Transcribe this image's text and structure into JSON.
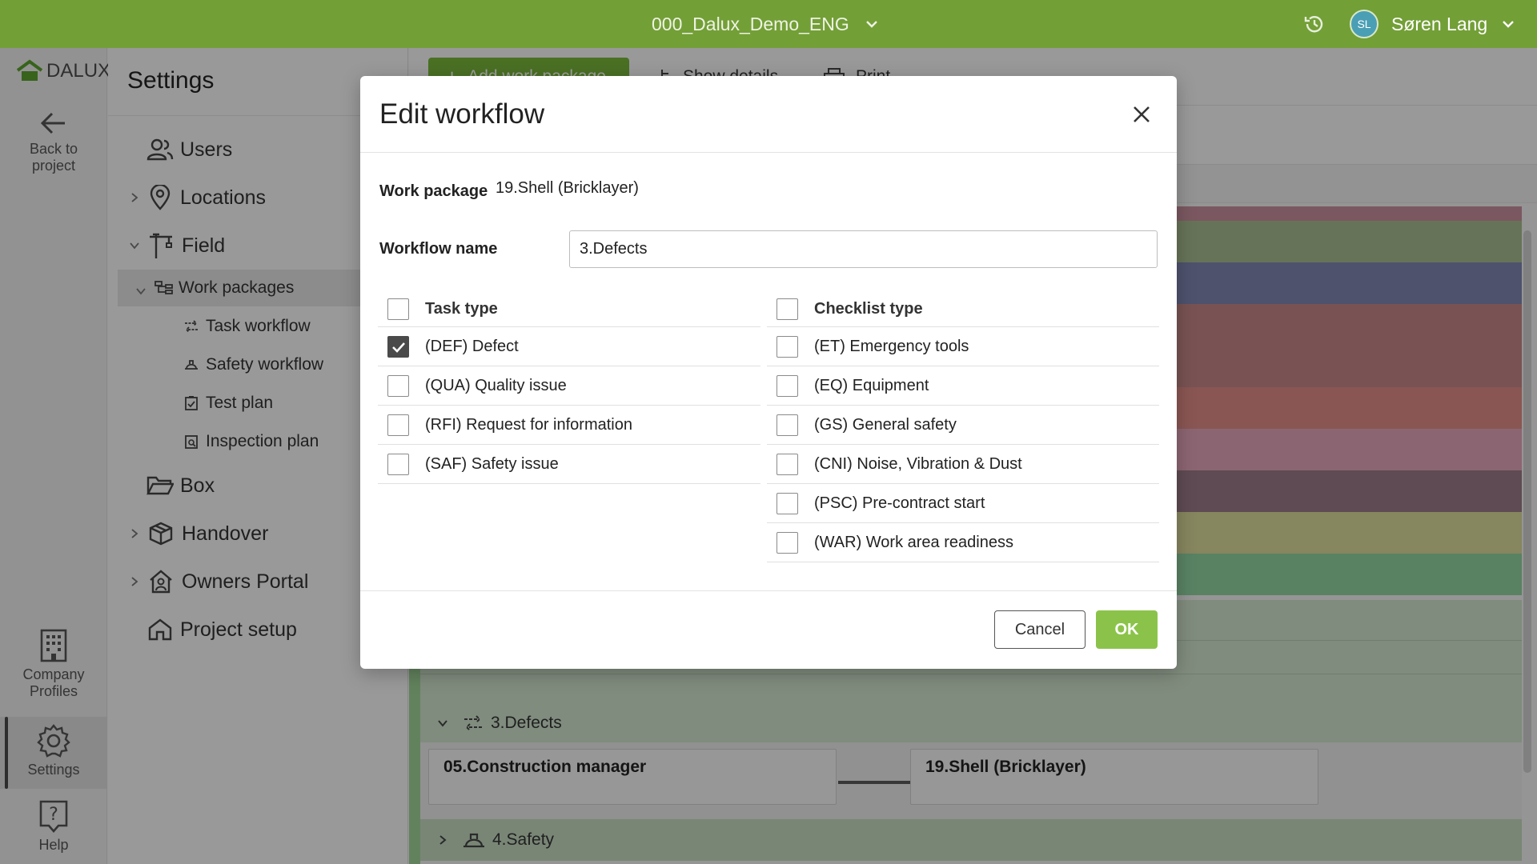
{
  "topbar": {
    "project_name": "000_Dalux_Demo_ENG",
    "user_initials": "SL",
    "user_name": "Søren Lang"
  },
  "rail": {
    "logo_text": "DALUX",
    "back_line1": "Back to",
    "back_line2": "project",
    "company_line1": "Company",
    "company_line2": "Profiles",
    "settings": "Settings",
    "help": "Help"
  },
  "sidebar": {
    "title": "Settings",
    "users": "Users",
    "locations": "Locations",
    "field": "Field",
    "work_packages": "Work packages",
    "task_workflow": "Task workflow",
    "safety_workflow": "Safety workflow",
    "test_plan": "Test plan",
    "inspection_plan": "Inspection plan",
    "box": "Box",
    "handover": "Handover",
    "owners_portal": "Owners Portal",
    "project_setup": "Project setup"
  },
  "content": {
    "add_work_package": "Add work package",
    "show_details": "Show details",
    "print": "Print",
    "workflow_row": "3.Defects",
    "flow_from": "05.Construction manager",
    "flow_to": "19.Shell (Bricklayer)",
    "safety_row": "4.Safety",
    "stripe_colors": [
      "#c78e9d",
      "#a6ba8f",
      "#7f85b0",
      "#c48686",
      "#c48686",
      "#df8b86",
      "#e3a4b8",
      "#9a7a87",
      "#d9d89a",
      "#90d2a0"
    ]
  },
  "modal": {
    "title": "Edit workflow",
    "work_package_label": "Work package",
    "work_package_value": "19.Shell (Bricklayer)",
    "workflow_name_label": "Workflow name",
    "workflow_name_value": "3.Defects",
    "task_type_header": "Task type",
    "checklist_type_header": "Checklist type",
    "task_types": [
      {
        "label": "(DEF) Defect",
        "checked": true
      },
      {
        "label": "(QUA) Quality issue",
        "checked": false
      },
      {
        "label": "(RFI) Request for information",
        "checked": false
      },
      {
        "label": "(SAF) Safety issue",
        "checked": false
      }
    ],
    "checklist_types": [
      {
        "label": "(ET) Emergency tools",
        "checked": false
      },
      {
        "label": "(EQ) Equipment",
        "checked": false
      },
      {
        "label": "(GS) General safety",
        "checked": false
      },
      {
        "label": "(CNI) Noise, Vibration & Dust",
        "checked": false
      },
      {
        "label": "(PSC) Pre-contract start",
        "checked": false
      },
      {
        "label": "(WAR) Work area readiness",
        "checked": false
      }
    ],
    "cancel_label": "Cancel",
    "ok_label": "OK"
  },
  "colors": {
    "topbar": "#739f37",
    "ok_button": "#8bc34a",
    "add_button": "#78b53a",
    "avatar": "#4a9fb5"
  }
}
